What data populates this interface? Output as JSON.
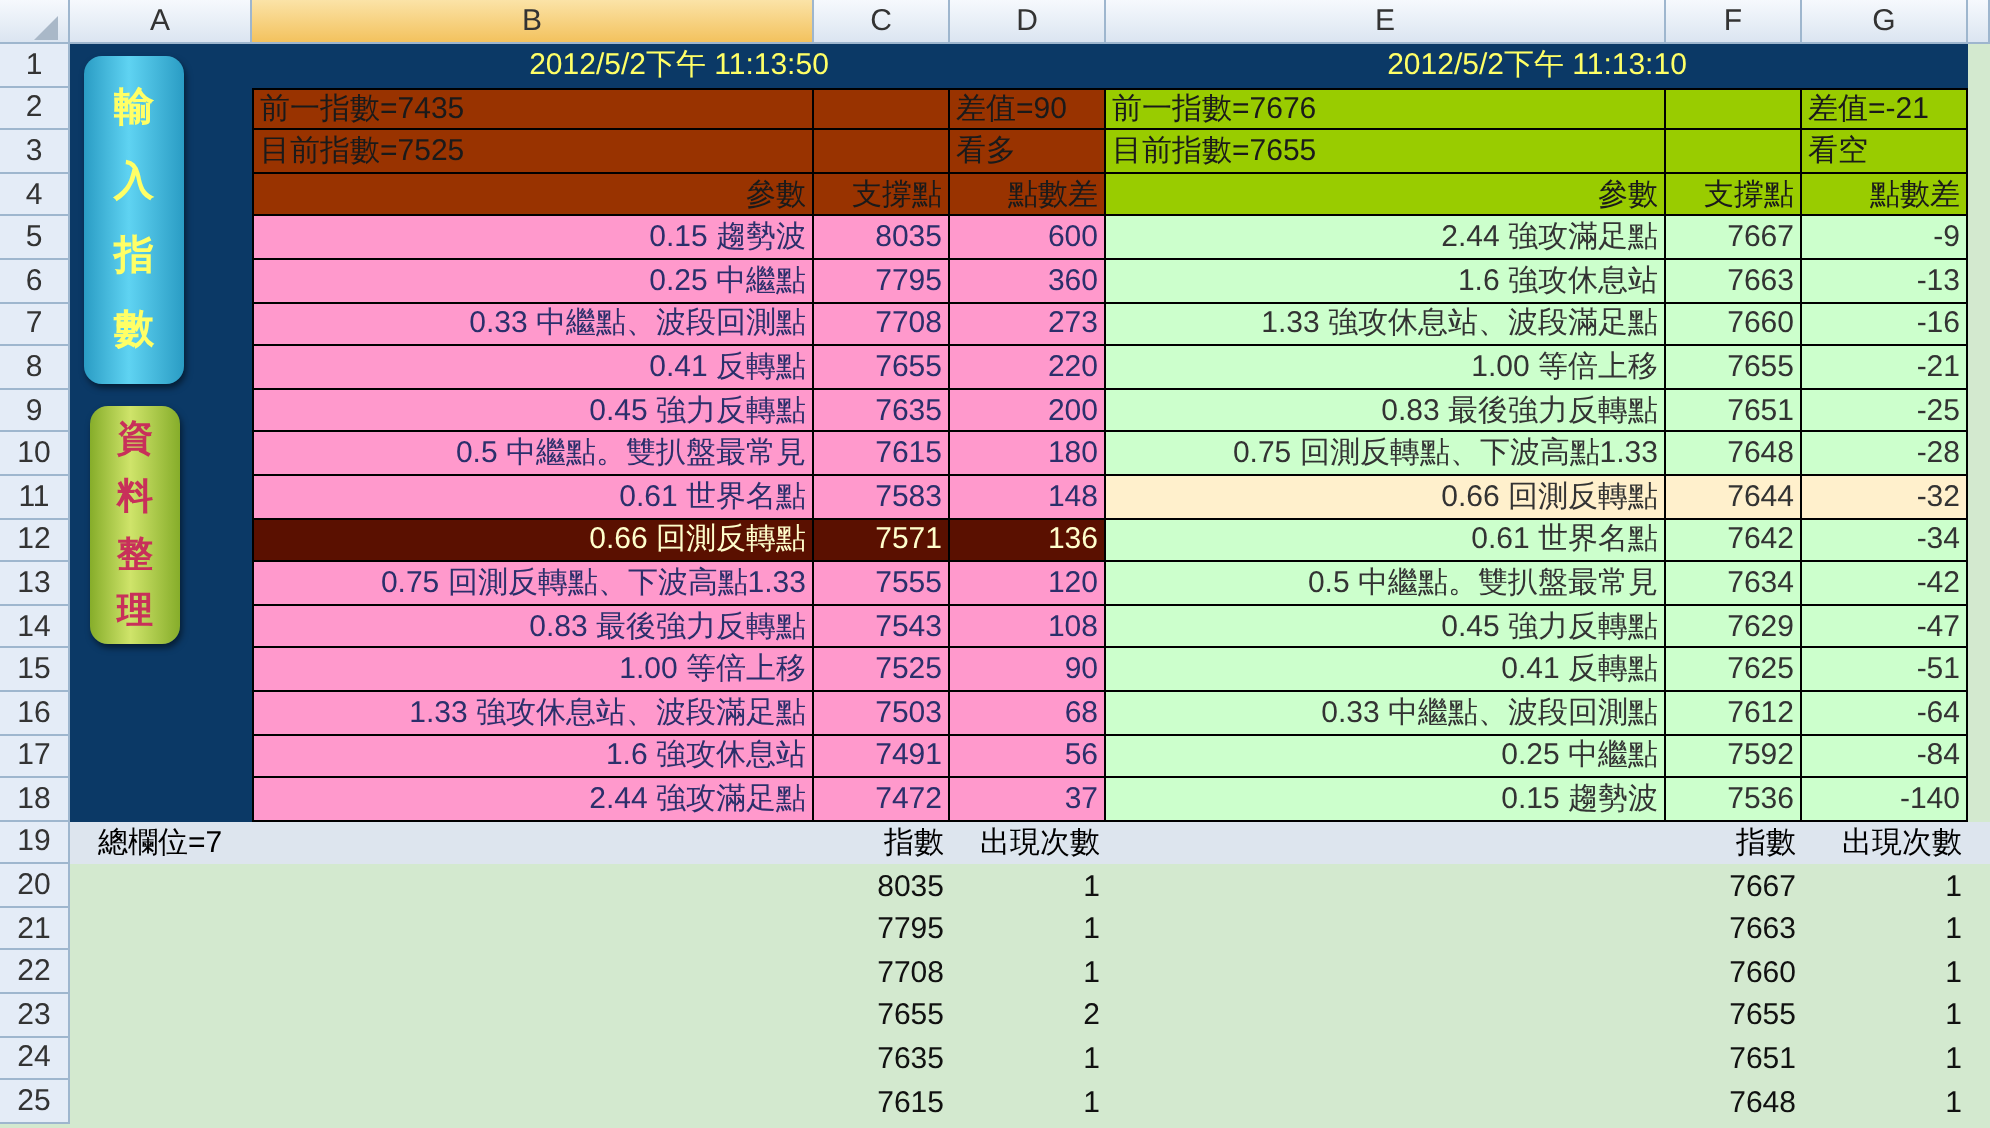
{
  "column_headers": [
    {
      "label": "A",
      "selected": false
    },
    {
      "label": "B",
      "selected": true
    },
    {
      "label": "C",
      "selected": false
    },
    {
      "label": "D",
      "selected": false
    },
    {
      "label": "E",
      "selected": false
    },
    {
      "label": "F",
      "selected": false
    },
    {
      "label": "G",
      "selected": false
    }
  ],
  "row_numbers": [
    "1",
    "2",
    "3",
    "4",
    "5",
    "6",
    "7",
    "8",
    "9",
    "10",
    "11",
    "12",
    "13",
    "14",
    "15",
    "16",
    "17",
    "18",
    "19",
    "20",
    "21",
    "22",
    "23",
    "24",
    "25"
  ],
  "buttons": [
    {
      "label": "輸入指數",
      "kind": "blue"
    },
    {
      "label": "資料整理",
      "kind": "green"
    }
  ],
  "left_table": {
    "kind": "bull",
    "timestamp": "2012/5/2下午 11:13:50",
    "previous": "前一指數=7435",
    "current": "目前指數=7525",
    "difference": "差值=90",
    "outlook": "看多",
    "columns": [
      "參數",
      "支撐點",
      "點數差"
    ],
    "rows": [
      {
        "cells": [
          "0.15 趨勢波",
          "8035",
          "600"
        ],
        "selected": false
      },
      {
        "cells": [
          "0.25 中繼點",
          "7795",
          "360"
        ],
        "selected": false
      },
      {
        "cells": [
          "0.33 中繼點、波段回測點",
          "7708",
          "273"
        ],
        "selected": false
      },
      {
        "cells": [
          "0.41 反轉點",
          "7655",
          "220"
        ],
        "selected": false
      },
      {
        "cells": [
          "0.45 強力反轉點",
          "7635",
          "200"
        ],
        "selected": false
      },
      {
        "cells": [
          "0.5  中繼點。雙扒盤最常見",
          "7615",
          "180"
        ],
        "selected": false
      },
      {
        "cells": [
          "0.61 世界名點",
          "7583",
          "148"
        ],
        "selected": false
      },
      {
        "cells": [
          "0.66 回測反轉點",
          "7571",
          "136"
        ],
        "selected": true
      },
      {
        "cells": [
          "0.75 回測反轉點、下波高點1.33",
          "7555",
          "120"
        ],
        "selected": false
      },
      {
        "cells": [
          "0.83 最後強力反轉點",
          "7543",
          "108"
        ],
        "selected": false
      },
      {
        "cells": [
          "1.00 等倍上移",
          "7525",
          "90"
        ],
        "selected": false
      },
      {
        "cells": [
          "1.33 強攻休息站、波段滿足點",
          "7503",
          "68"
        ],
        "selected": false
      },
      {
        "cells": [
          "1.6  強攻休息站",
          "7491",
          "56"
        ],
        "selected": false
      },
      {
        "cells": [
          "2.44 強攻滿足點",
          "7472",
          "37"
        ],
        "selected": false
      }
    ]
  },
  "right_table": {
    "kind": "bear",
    "timestamp": "2012/5/2下午 11:13:10",
    "previous": "前一指數=7676",
    "current": "目前指數=7655",
    "difference": "差值=-21",
    "outlook": "看空",
    "columns": [
      "參數",
      "支撐點",
      "點數差"
    ],
    "rows": [
      {
        "cells": [
          "2.44 強攻滿足點",
          "7667",
          "-9"
        ],
        "selected": false
      },
      {
        "cells": [
          "1.6  強攻休息站",
          "7663",
          "-13"
        ],
        "selected": false
      },
      {
        "cells": [
          "1.33 強攻休息站、波段滿足點",
          "7660",
          "-16"
        ],
        "selected": false
      },
      {
        "cells": [
          "1.00 等倍上移",
          "7655",
          "-21"
        ],
        "selected": false
      },
      {
        "cells": [
          "0.83 最後強力反轉點",
          "7651",
          "-25"
        ],
        "selected": false
      },
      {
        "cells": [
          "0.75 回測反轉點、下波高點1.33",
          "7648",
          "-28"
        ],
        "selected": false
      },
      {
        "cells": [
          "0.66 回測反轉點",
          "7644",
          "-32"
        ],
        "selected": true
      },
      {
        "cells": [
          "0.61 世界名點",
          "7642",
          "-34"
        ],
        "selected": false
      },
      {
        "cells": [
          "0.5  中繼點。雙扒盤最常見",
          "7634",
          "-42"
        ],
        "selected": false
      },
      {
        "cells": [
          "0.45 強力反轉點",
          "7629",
          "-47"
        ],
        "selected": false
      },
      {
        "cells": [
          "0.41 反轉點",
          "7625",
          "-51"
        ],
        "selected": false
      },
      {
        "cells": [
          "0.33 中繼點、波段回測點",
          "7612",
          "-64"
        ],
        "selected": false
      },
      {
        "cells": [
          "0.25 中繼點",
          "7592",
          "-84"
        ],
        "selected": false
      },
      {
        "cells": [
          "0.15 趨勢波",
          "7536",
          "-140"
        ],
        "selected": false
      }
    ]
  },
  "summary": {
    "total": "總欄位=7",
    "left": {
      "columns": [
        "指數",
        "出現次數"
      ],
      "rows": [
        {
          "cells": [
            "8035",
            "1"
          ]
        },
        {
          "cells": [
            "7795",
            "1"
          ]
        },
        {
          "cells": [
            "7708",
            "1"
          ]
        },
        {
          "cells": [
            "7655",
            "2"
          ]
        },
        {
          "cells": [
            "7635",
            "1"
          ]
        },
        {
          "cells": [
            "7615",
            "1"
          ]
        }
      ]
    },
    "right": {
      "columns": [
        "指數",
        "出現次數"
      ],
      "rows": [
        {
          "cells": [
            "7667",
            "1"
          ]
        },
        {
          "cells": [
            "7663",
            "1"
          ]
        },
        {
          "cells": [
            "7660",
            "1"
          ]
        },
        {
          "cells": [
            "7655",
            "1"
          ]
        },
        {
          "cells": [
            "7651",
            "1"
          ]
        },
        {
          "cells": [
            "7648",
            "1"
          ]
        }
      ]
    }
  }
}
